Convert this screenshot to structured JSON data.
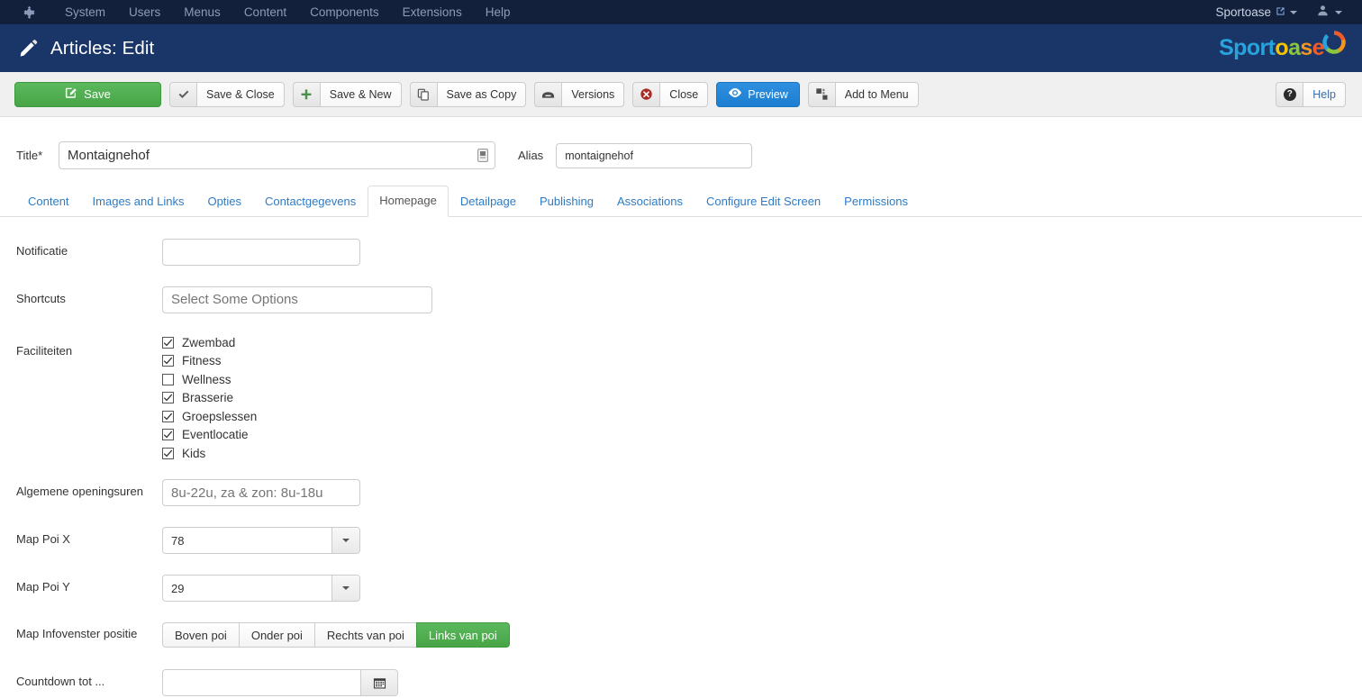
{
  "navbar": {
    "logo_icon": "joomla-logo-icon",
    "items": [
      {
        "label": "System"
      },
      {
        "label": "Users"
      },
      {
        "label": "Menus"
      },
      {
        "label": "Content"
      },
      {
        "label": "Components"
      },
      {
        "label": "Extensions"
      },
      {
        "label": "Help"
      }
    ],
    "site_name": "Sportoase",
    "site_external_icon": "external-link-icon",
    "user_icon": "user-icon"
  },
  "subhead": {
    "icon": "pencil-icon",
    "title": "Articles: Edit",
    "brand": {
      "part1": "Sport",
      "part2": "o",
      "part3": "a",
      "part4": "s",
      "part5": "e",
      "ring_icon": "sportoase-ring-icon"
    }
  },
  "toolbar": {
    "save": {
      "label": "Save",
      "icon": "save-pencil-icon"
    },
    "save_close": {
      "label": "Save & Close",
      "icon": "check-icon"
    },
    "save_new": {
      "label": "Save & New",
      "icon": "plus-icon"
    },
    "save_copy": {
      "label": "Save as Copy",
      "icon": "copy-icon"
    },
    "versions": {
      "label": "Versions",
      "icon": "archive-icon"
    },
    "close": {
      "label": "Close",
      "icon": "close-circle-icon"
    },
    "preview": {
      "label": "Preview",
      "icon": "eye-icon"
    },
    "add_to_menu": {
      "label": "Add to Menu",
      "icon": "menu-grid-icon"
    },
    "help": {
      "label": "Help",
      "icon": "question-circle-icon"
    }
  },
  "header_form": {
    "title_label": "Title",
    "title_required_mark": "*",
    "title_value": "Montaignehof",
    "title_editor_icon": "editor-toggle-icon",
    "alias_label": "Alias",
    "alias_value": "montaignehof"
  },
  "tabs": [
    {
      "label": "Content",
      "active": false
    },
    {
      "label": "Images and Links",
      "active": false
    },
    {
      "label": "Opties",
      "active": false
    },
    {
      "label": "Contactgegevens",
      "active": false
    },
    {
      "label": "Homepage",
      "active": true
    },
    {
      "label": "Detailpage",
      "active": false
    },
    {
      "label": "Publishing",
      "active": false
    },
    {
      "label": "Associations",
      "active": false
    },
    {
      "label": "Configure Edit Screen",
      "active": false
    },
    {
      "label": "Permissions",
      "active": false
    }
  ],
  "fields": {
    "notificatie": {
      "label": "Notificatie",
      "value": "",
      "placeholder": ""
    },
    "shortcuts": {
      "label": "Shortcuts",
      "value": "",
      "placeholder": "Select Some Options"
    },
    "faciliteiten": {
      "label": "Faciliteiten",
      "options": [
        {
          "label": "Zwembad",
          "checked": true
        },
        {
          "label": "Fitness",
          "checked": true
        },
        {
          "label": "Wellness",
          "checked": false
        },
        {
          "label": "Brasserie",
          "checked": true
        },
        {
          "label": "Groepslessen",
          "checked": true
        },
        {
          "label": "Eventlocatie",
          "checked": true
        },
        {
          "label": "Kids",
          "checked": true
        }
      ]
    },
    "openingsuren": {
      "label": "Algemene openingsuren",
      "value": "",
      "placeholder": "8u-22u, za & zon: 8u-18u"
    },
    "map_poi_x": {
      "label": "Map Poi X",
      "value": "78",
      "caret_icon": "chevron-down-icon"
    },
    "map_poi_y": {
      "label": "Map Poi Y",
      "value": "29",
      "caret_icon": "chevron-down-icon"
    },
    "map_infovenster": {
      "label": "Map Infovenster positie",
      "options": [
        {
          "label": "Boven poi",
          "active": false
        },
        {
          "label": "Onder poi",
          "active": false
        },
        {
          "label": "Rechts van poi",
          "active": false
        },
        {
          "label": "Links van poi",
          "active": true
        }
      ]
    },
    "countdown": {
      "label": "Countdown tot ...",
      "value": "",
      "placeholder": "",
      "calendar_icon": "calendar-icon"
    }
  },
  "colors": {
    "navbar_bg": "#12203c",
    "subhead_bg": "#1a3668",
    "toolbar_bg": "#f0f0f0",
    "save_green": "#47a447",
    "preview_blue": "#1c7ed0",
    "tab_link": "#2e7bc4"
  }
}
